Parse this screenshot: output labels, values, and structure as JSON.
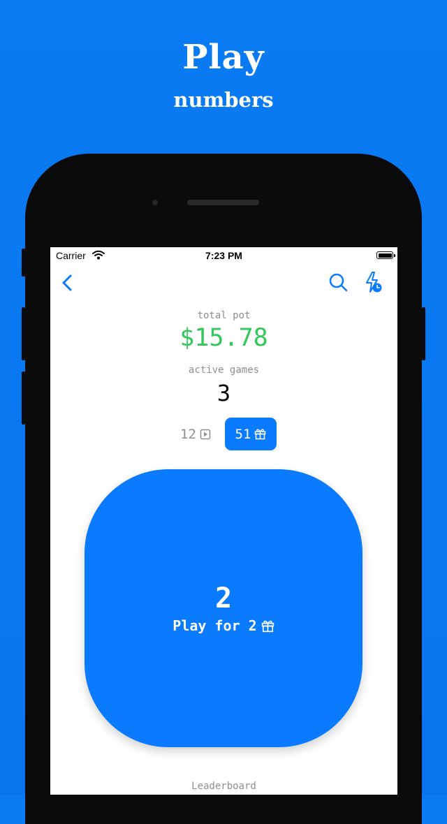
{
  "promo": {
    "title": "Play",
    "subtitle": "numbers"
  },
  "status_bar": {
    "carrier": "Carrier",
    "time": "7:23 PM"
  },
  "nav": {
    "back_icon": "chevron-left-icon",
    "search_icon": "search-icon",
    "activity_icon": "bolt-clock-icon"
  },
  "stats": {
    "total_pot_label": "total pot",
    "total_pot_value": "$15.78",
    "active_games_label": "active games",
    "active_games_value": "3"
  },
  "toggle": {
    "plays_count": "12",
    "plays_icon": "play-square-icon",
    "gifts_count": "51",
    "gifts_icon": "gift-icon",
    "selected": "gifts"
  },
  "play_button": {
    "number": "2",
    "label": "Play for 2",
    "icon": "gift-icon"
  },
  "footer": {
    "leaderboard_label": "Leaderboard"
  },
  "colors": {
    "background": "#0a7bf3",
    "accent": "#0a7aff",
    "pot_green": "#34c759",
    "label_gray": "#8e8e93",
    "phone_frame": "#0b0b0c"
  }
}
